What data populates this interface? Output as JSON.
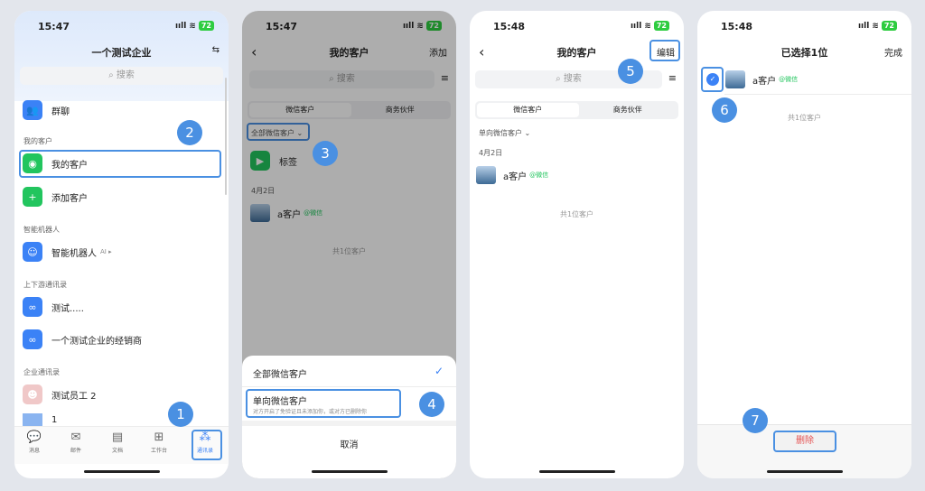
{
  "status": {
    "p1_time": "15:47",
    "p2_time": "15:47",
    "p3_time": "15:48",
    "p4_time": "15:48",
    "signal": "ııll",
    "wifi": "≋",
    "battery": "72"
  },
  "p1": {
    "title": "一个测试企业",
    "search_placeholder": "搜索",
    "group_chat": "群聊",
    "sec_my_customers": "我的客户",
    "my_customers": "我的客户",
    "add_customer": "添加客户",
    "sec_bots": "智能机器人",
    "smart_bot": "智能机器人",
    "ai_tag": "AI ▸",
    "sec_updown": "上下游通讯录",
    "contact1": "测试.....",
    "contact2": "一个测试企业的经销商",
    "sec_corp": "企业通讯录",
    "employee2": "测试员工 2",
    "employee_partial": "1",
    "tabs": [
      "消息",
      "邮件",
      "文档",
      "工作台",
      "通讯录"
    ]
  },
  "p2": {
    "title": "我的客户",
    "add": "添加",
    "search_placeholder": "搜索",
    "seg_on": "微信客户",
    "seg_off": "商务伙伴",
    "filter": "全部微信客户 ⌄",
    "tag": "标签",
    "date": "4月2日",
    "customer": "a客户",
    "wechat": "@微信",
    "total": "共1位客户",
    "opt_all": "全部微信客户",
    "opt_single": "单向微信客户",
    "opt_single_sub": "对方开启了免验证且未添加你，或对方已删除你",
    "cancel": "取消"
  },
  "p3": {
    "title": "我的客户",
    "edit": "编辑",
    "search_placeholder": "搜索",
    "seg_on": "微信客户",
    "seg_off": "商务伙伴",
    "filter": "单向微信客户 ⌄",
    "date": "4月2日",
    "customer": "a客户",
    "wechat": "@微信",
    "total": "共1位客户"
  },
  "p4": {
    "title": "已选择1位",
    "done": "完成",
    "customer": "a客户",
    "wechat": "@微信",
    "total": "共1位客户",
    "delete": "删除"
  },
  "badges": [
    "1",
    "2",
    "3",
    "4",
    "5",
    "6",
    "7"
  ],
  "colors": {
    "accent": "#4a90e2",
    "blue": "#3b82f6",
    "green": "#22c55e",
    "danger": "#e55353"
  }
}
